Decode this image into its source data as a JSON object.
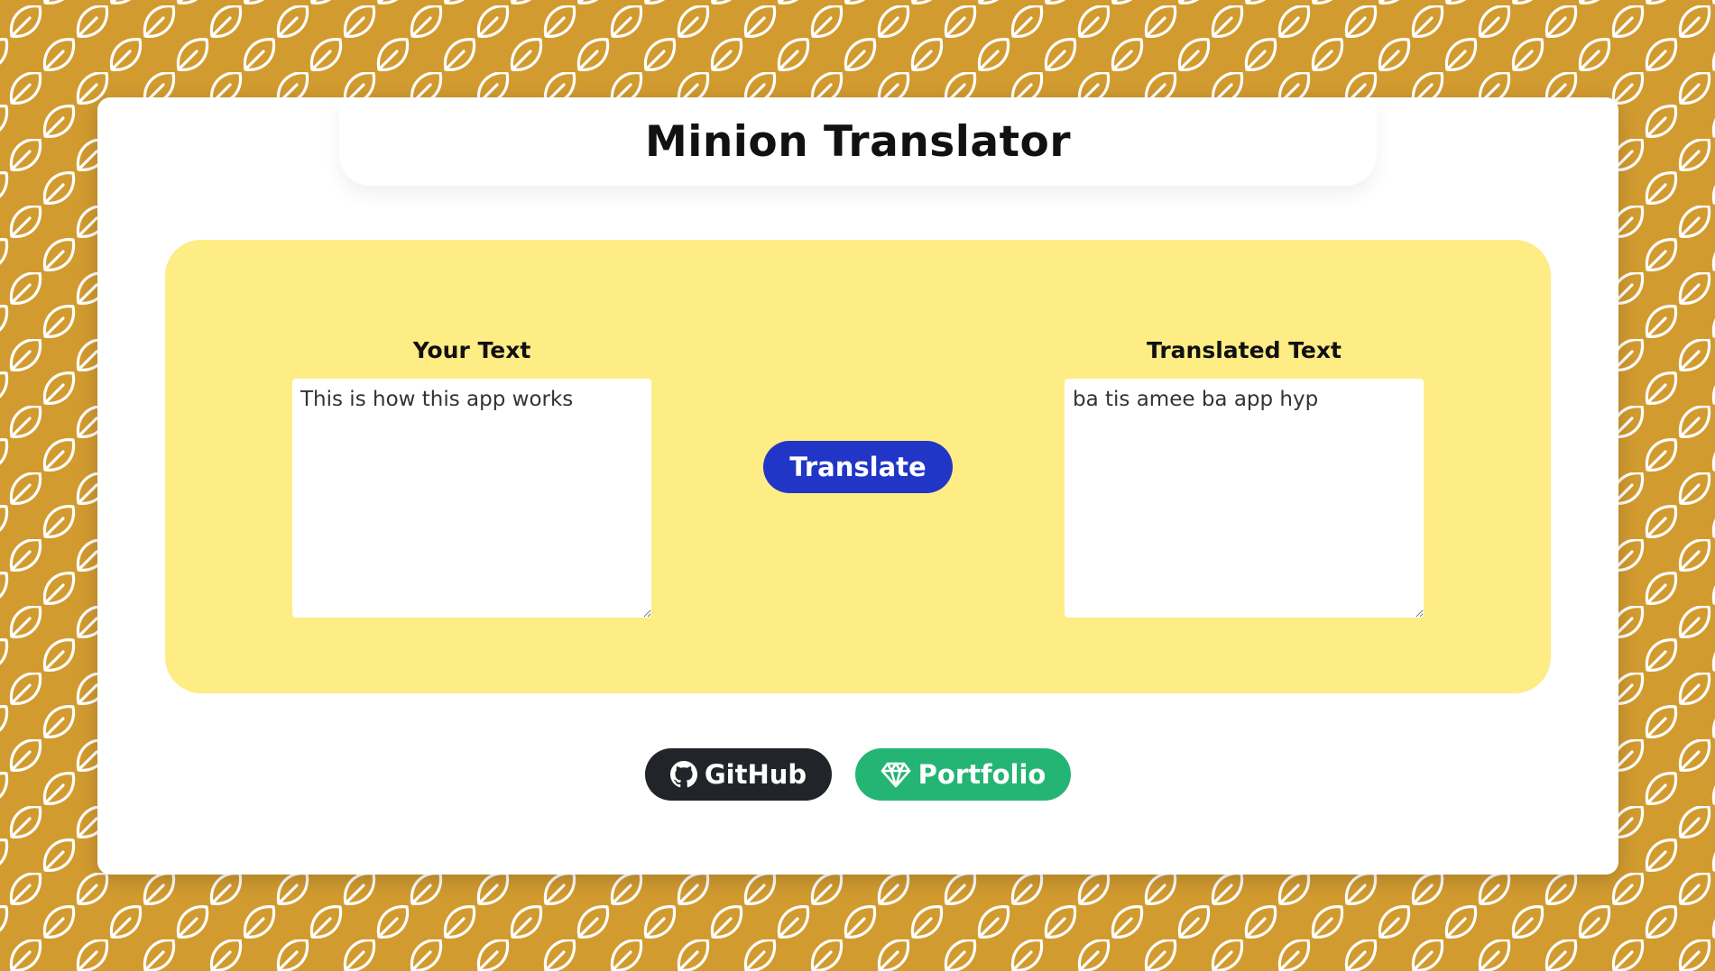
{
  "app": {
    "title": "Minion Translator"
  },
  "input": {
    "label": "Your Text",
    "value": "This is how this app works"
  },
  "output": {
    "label": "Translated Text",
    "value": "ba tis amee ba app hyp"
  },
  "actions": {
    "translate_label": "Translate"
  },
  "footer": {
    "github_label": "GitHub",
    "github_icon": "github-icon",
    "portfolio_label": "Portfolio",
    "portfolio_icon": "gem-icon"
  },
  "colors": {
    "background": "#D29B30",
    "panel": "#FEEC84",
    "translate_button": "#2136C6",
    "github_button": "#212529",
    "portfolio_button": "#24B574"
  }
}
